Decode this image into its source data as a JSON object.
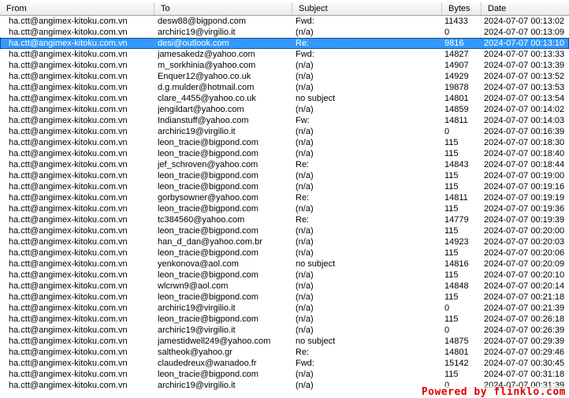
{
  "columns": {
    "from": "From",
    "to": "To",
    "subject": "Subject",
    "bytes": "Bytes",
    "date": "Date"
  },
  "selected_row_index": 2,
  "rows": [
    {
      "from": "ha.ctt@angimex-kitoku.com.vn",
      "to": "desw88@bigpond.com",
      "subject": "Fwd:",
      "bytes": "11433",
      "date": "2024-07-07 00:13:02"
    },
    {
      "from": "ha.ctt@angimex-kitoku.com.vn",
      "to": "archiric19@virgilio.it",
      "subject": "(n/a)",
      "bytes": "0",
      "date": "2024-07-07 00:13:09"
    },
    {
      "from": "ha.ctt@angimex-kitoku.com.vn",
      "to": "desi@outlook.com",
      "subject": "Re:",
      "bytes": "9816",
      "date": "2024-07-07 00:13:10"
    },
    {
      "from": "ha.ctt@angimex-kitoku.com.vn",
      "to": "jamesakedz@yahoo.com",
      "subject": "Fwd:",
      "bytes": "14827",
      "date": "2024-07-07 00:13:33"
    },
    {
      "from": "ha.ctt@angimex-kitoku.com.vn",
      "to": "m_sorkhinia@yahoo.com",
      "subject": "(n/a)",
      "bytes": "14907",
      "date": "2024-07-07 00:13:39"
    },
    {
      "from": "ha.ctt@angimex-kitoku.com.vn",
      "to": "Enquer12@yahoo.co.uk",
      "subject": "(n/a)",
      "bytes": "14929",
      "date": "2024-07-07 00:13:52"
    },
    {
      "from": "ha.ctt@angimex-kitoku.com.vn",
      "to": "d.g.mulder@hotmail.com",
      "subject": "(n/a)",
      "bytes": "19878",
      "date": "2024-07-07 00:13:53"
    },
    {
      "from": "ha.ctt@angimex-kitoku.com.vn",
      "to": "clare_4455@yahoo.co.uk",
      "subject": "no subject",
      "bytes": "14801",
      "date": "2024-07-07 00:13:54"
    },
    {
      "from": "ha.ctt@angimex-kitoku.com.vn",
      "to": "jengildart@yahoo.com",
      "subject": "(n/a)",
      "bytes": "14859",
      "date": "2024-07-07 00:14:02"
    },
    {
      "from": "ha.ctt@angimex-kitoku.com.vn",
      "to": "Indianstuff@yahoo.com",
      "subject": "Fw:",
      "bytes": "14811",
      "date": "2024-07-07 00:14:03"
    },
    {
      "from": "ha.ctt@angimex-kitoku.com.vn",
      "to": "archiric19@virgilio.it",
      "subject": "(n/a)",
      "bytes": "0",
      "date": "2024-07-07 00:16:39"
    },
    {
      "from": "ha.ctt@angimex-kitoku.com.vn",
      "to": "leon_tracie@bigpond.com",
      "subject": "(n/a)",
      "bytes": "115",
      "date": "2024-07-07 00:18:30"
    },
    {
      "from": "ha.ctt@angimex-kitoku.com.vn",
      "to": "leon_tracie@bigpond.com",
      "subject": "(n/a)",
      "bytes": "115",
      "date": "2024-07-07 00:18:40"
    },
    {
      "from": "ha.ctt@angimex-kitoku.com.vn",
      "to": "jef_schroven@yahoo.com",
      "subject": "Re:",
      "bytes": "14843",
      "date": "2024-07-07 00:18:44"
    },
    {
      "from": "ha.ctt@angimex-kitoku.com.vn",
      "to": "leon_tracie@bigpond.com",
      "subject": "(n/a)",
      "bytes": "115",
      "date": "2024-07-07 00:19:00"
    },
    {
      "from": "ha.ctt@angimex-kitoku.com.vn",
      "to": "leon_tracie@bigpond.com",
      "subject": "(n/a)",
      "bytes": "115",
      "date": "2024-07-07 00:19:16"
    },
    {
      "from": "ha.ctt@angimex-kitoku.com.vn",
      "to": "gorbysowner@yahoo.com",
      "subject": "Re:",
      "bytes": "14811",
      "date": "2024-07-07 00:19:19"
    },
    {
      "from": "ha.ctt@angimex-kitoku.com.vn",
      "to": "leon_tracie@bigpond.com",
      "subject": "(n/a)",
      "bytes": "115",
      "date": "2024-07-07 00:19:36"
    },
    {
      "from": "ha.ctt@angimex-kitoku.com.vn",
      "to": "tc384560@yahoo.com",
      "subject": "Re:",
      "bytes": "14779",
      "date": "2024-07-07 00:19:39"
    },
    {
      "from": "ha.ctt@angimex-kitoku.com.vn",
      "to": "leon_tracie@bigpond.com",
      "subject": "(n/a)",
      "bytes": "115",
      "date": "2024-07-07 00:20:00"
    },
    {
      "from": "ha.ctt@angimex-kitoku.com.vn",
      "to": "han_d_dan@yahoo.com.br",
      "subject": "(n/a)",
      "bytes": "14923",
      "date": "2024-07-07 00:20:03"
    },
    {
      "from": "ha.ctt@angimex-kitoku.com.vn",
      "to": "leon_tracie@bigpond.com",
      "subject": "(n/a)",
      "bytes": "115",
      "date": "2024-07-07 00:20:06"
    },
    {
      "from": "ha.ctt@angimex-kitoku.com.vn",
      "to": "yenkonova@aol.com",
      "subject": "no subject",
      "bytes": "14816",
      "date": "2024-07-07 00:20:09"
    },
    {
      "from": "ha.ctt@angimex-kitoku.com.vn",
      "to": "leon_tracie@bigpond.com",
      "subject": "(n/a)",
      "bytes": "115",
      "date": "2024-07-07 00:20:10"
    },
    {
      "from": "ha.ctt@angimex-kitoku.com.vn",
      "to": "wlcrwn9@aol.com",
      "subject": "(n/a)",
      "bytes": "14848",
      "date": "2024-07-07 00:20:14"
    },
    {
      "from": "ha.ctt@angimex-kitoku.com.vn",
      "to": "leon_tracie@bigpond.com",
      "subject": "(n/a)",
      "bytes": "115",
      "date": "2024-07-07 00:21:18"
    },
    {
      "from": "ha.ctt@angimex-kitoku.com.vn",
      "to": "archiric19@virgilio.it",
      "subject": "(n/a)",
      "bytes": "0",
      "date": "2024-07-07 00:21:39"
    },
    {
      "from": "ha.ctt@angimex-kitoku.com.vn",
      "to": "leon_tracie@bigpond.com",
      "subject": "(n/a)",
      "bytes": "115",
      "date": "2024-07-07 00:26:18"
    },
    {
      "from": "ha.ctt@angimex-kitoku.com.vn",
      "to": "archiric19@virgilio.it",
      "subject": "(n/a)",
      "bytes": "0",
      "date": "2024-07-07 00:26:39"
    },
    {
      "from": "ha.ctt@angimex-kitoku.com.vn",
      "to": "jamestidwell249@yahoo.com",
      "subject": "no subject",
      "bytes": "14875",
      "date": "2024-07-07 00:29:39"
    },
    {
      "from": "ha.ctt@angimex-kitoku.com.vn",
      "to": "saltheok@yahoo.gr",
      "subject": "Re:",
      "bytes": "14801",
      "date": "2024-07-07 00:29:46"
    },
    {
      "from": "ha.ctt@angimex-kitoku.com.vn",
      "to": "claudedreux@wanadoo.fr",
      "subject": "Fwd:",
      "bytes": "15142",
      "date": "2024-07-07 00:30:45"
    },
    {
      "from": "ha.ctt@angimex-kitoku.com.vn",
      "to": "leon_tracie@bigpond.com",
      "subject": "(n/a)",
      "bytes": "115",
      "date": "2024-07-07 00:31:18"
    },
    {
      "from": "ha.ctt@angimex-kitoku.com.vn",
      "to": "archiric19@virgilio.it",
      "subject": "(n/a)",
      "bytes": "0",
      "date": "2024-07-07 00:31:39"
    }
  ],
  "watermark": "Powered by flinklo.com"
}
